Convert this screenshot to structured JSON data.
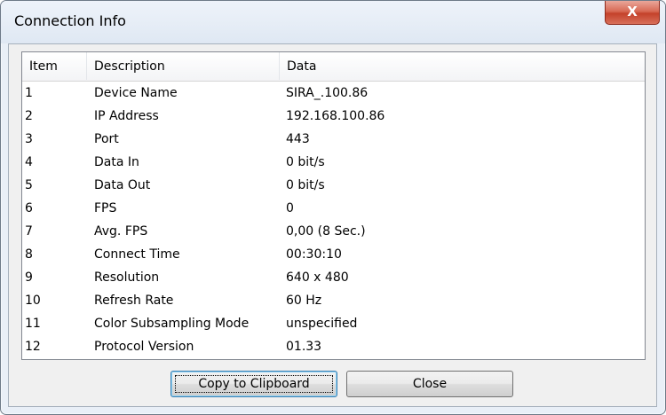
{
  "window": {
    "title": "Connection Info",
    "close_glyph": "X"
  },
  "table": {
    "headers": {
      "item": "Item",
      "description": "Description",
      "data": "Data"
    },
    "rows": [
      {
        "item": "1",
        "description": "Device Name",
        "data": "SIRA_.100.86"
      },
      {
        "item": "2",
        "description": "IP Address",
        "data": "192.168.100.86"
      },
      {
        "item": "3",
        "description": "Port",
        "data": "443"
      },
      {
        "item": "4",
        "description": "Data In",
        "data": "0 bit/s"
      },
      {
        "item": "5",
        "description": "Data Out",
        "data": "0 bit/s"
      },
      {
        "item": "6",
        "description": "FPS",
        "data": "0"
      },
      {
        "item": "7",
        "description": "Avg. FPS",
        "data": "0,00 (8 Sec.)"
      },
      {
        "item": "8",
        "description": "Connect Time",
        "data": "00:30:10"
      },
      {
        "item": "9",
        "description": "Resolution",
        "data": "640 x 480"
      },
      {
        "item": "10",
        "description": "Refresh Rate",
        "data": "60 Hz"
      },
      {
        "item": "11",
        "description": "Color Subsampling Mode",
        "data": "unspecified"
      },
      {
        "item": "12",
        "description": "Protocol Version",
        "data": "01.33"
      }
    ]
  },
  "buttons": {
    "copy_label": "Copy to Clipboard",
    "close_label": "Close"
  }
}
